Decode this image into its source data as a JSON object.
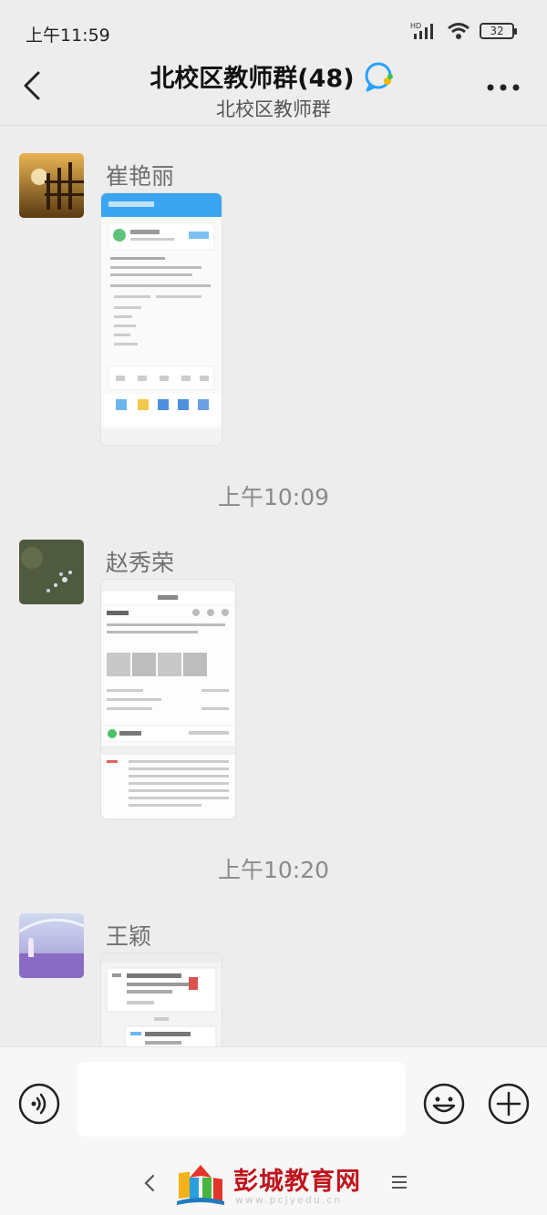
{
  "status_bar": {
    "time": "上午11:59",
    "battery": "32",
    "hd": "HD"
  },
  "header": {
    "title": "北校区教师群(48)",
    "subtitle": "北校区教师群"
  },
  "messages": [
    {
      "sender": "崔艳丽",
      "type": "image"
    },
    {
      "time": "上午10:09"
    },
    {
      "sender": "赵秀荣",
      "type": "image"
    },
    {
      "time": "上午10:20"
    },
    {
      "sender": "王颖",
      "type": "image"
    }
  ],
  "icons": {
    "back": "chevron-left-icon",
    "title_badge": "chat-bubble-icon",
    "more": "more-dots-icon",
    "voice": "voice-icon",
    "emoji": "emoji-icon",
    "plus": "plus-icon"
  },
  "input": {
    "value": "",
    "placeholder": ""
  },
  "watermark": {
    "brand": "彭城教育网",
    "url": "www.pcjyedu.cn"
  },
  "colors": {
    "background": "#ededed",
    "brand_red": "#c0141c",
    "accent_blue": "#2aa1ff"
  }
}
